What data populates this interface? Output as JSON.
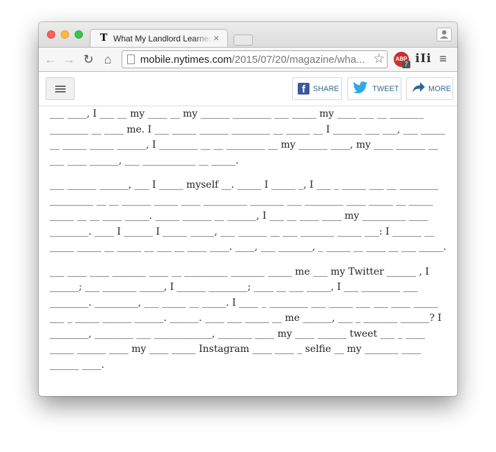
{
  "browser": {
    "tab_title": "What My Landlord Learned",
    "tab_close": "×",
    "url_host": "mobile.nytimes.com",
    "url_path": "/2015/07/20/magazine/wha...",
    "back_icon": "←",
    "forward_icon": "→",
    "reload_icon": "↻",
    "home_icon": "⌂",
    "star_icon": "☆",
    "abp_label": "ABP",
    "abp_count": "7",
    "reader_label": "iIi",
    "menu_icon": "≡",
    "favicon": "T"
  },
  "site_header": {
    "share_label": "SHARE",
    "tweet_label": "TWEET",
    "more_label": "MORE"
  },
  "article": {
    "paragraphs": [
      "___ ____, I ___ __ my ____ __ my ______ ________ ___ _____ my ____ ___ __ _______ ________ __ ____ me. I ___ _____ ______ ________ __ _____ __ I ______ ___ ___, ___ _____ __ _____ _____ ______, I ________ __ __ ________ __ my ______ ____, my ____ ______ __ ___ ____ ______, ___ ___________ __ _____.",
      "___ ______ ______, ___ I _____ myself __. _____ I _____ _, I ___ _ _____ ___ __ ________ _________ __ __ ______ _____ ____ _________ _______ ___ ________ ____ _____ __ _____ _____ __ __ ____ _____. _____ ______ __ ______, I ___ __ ____ ____ my _________ ____ ________. ____ I ______ I _____ _____, ___ ______ __ ___ _______ _____ ___: I ______ __ _____ _____ __ _____ __ ___ __ ____ ____. ____, ___ _______, _ _____ __ ____ __ ___ _____.",
      "___ ____ ____ _______ ____ __ _________ _______ _____ me ___ my Twitter ______ , I ______; ___ _______ _____, I ______ ________; ____ __ ___ _____, I ___ ________ ___ ________. _________, ___ _____ __ _____. I ____ _ ________ ___ _____ ___ ___ ____ _____ ___ _ _____ ______ ______. ______. ____ ___ _____ __ me ______, ___ _ _______ ______? I ________, ________ ___ ____________, _______ ____ my ____ ______ tweet ___ _ ____ _____ ______ ____ my ____ _____ Instagram ____ ____ _ selfie __ my _______ ____ ______ ____."
    ]
  }
}
